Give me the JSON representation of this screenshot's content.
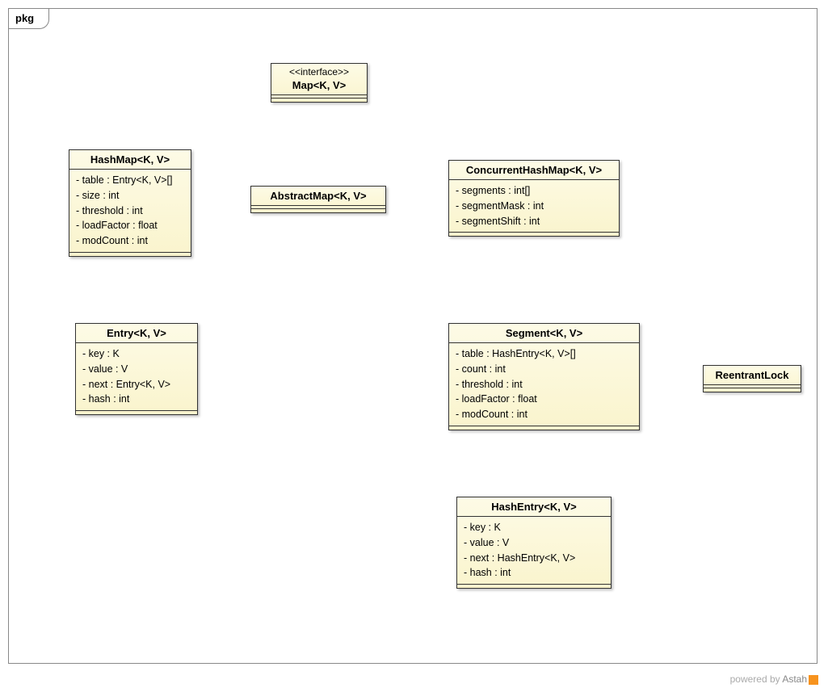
{
  "package": {
    "name": "pkg"
  },
  "classes": {
    "map": {
      "stereotype": "<<interface>>",
      "name": "Map<K, V>",
      "attrs": []
    },
    "abstractmap": {
      "name": "AbstractMap<K, V>",
      "attrs": []
    },
    "hashmap": {
      "name": "HashMap<K, V>",
      "attrs": [
        "- table : Entry<K, V>[]",
        "- size : int",
        "- threshold : int",
        "- loadFactor : float",
        "- modCount : int"
      ]
    },
    "concurrenthashmap": {
      "name": "ConcurrentHashMap<K, V>",
      "attrs": [
        "- segments : int[]",
        "- segmentMask : int",
        "- segmentShift : int"
      ]
    },
    "entry": {
      "name": "Entry<K, V>",
      "attrs": [
        "- key : K",
        "- value : V",
        "- next : Entry<K, V>",
        "- hash : int"
      ]
    },
    "segment": {
      "name": "Segment<K, V>",
      "attrs": [
        "- table : HashEntry<K, V>[]",
        "- count : int",
        "- threshold : int",
        "- loadFactor : float",
        "- modCount : int"
      ]
    },
    "reentrantlock": {
      "name": "ReentrantLock",
      "attrs": []
    },
    "hashentry": {
      "name": "HashEntry<K, V>",
      "attrs": [
        "- key : K",
        "- value : V",
        "- next : HashEntry<K, V>",
        "- hash : int"
      ]
    }
  },
  "watermark": {
    "prefix": "powered by ",
    "brand": "Astah"
  }
}
